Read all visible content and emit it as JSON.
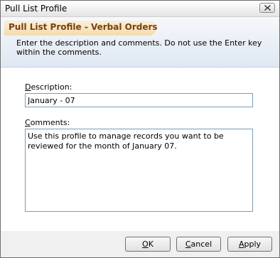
{
  "window": {
    "title": "Pull List Profile",
    "close_icon": "close-icon"
  },
  "header": {
    "title": "Pull List Profile - Verbal Orders",
    "instructions": "Enter the description and comments. Do not use the Enter key within the comments."
  },
  "form": {
    "description_label": "Description:",
    "description_value": "January - 07",
    "comments_label": "Comments:",
    "comments_value": "Use this profile to manage records you want to be reviewed for the month of January 07."
  },
  "buttons": {
    "ok": "OK",
    "cancel": "Cancel",
    "apply": "Apply"
  },
  "colors": {
    "header_title": "#7b3f10",
    "input_border": "#7a9cb8"
  }
}
